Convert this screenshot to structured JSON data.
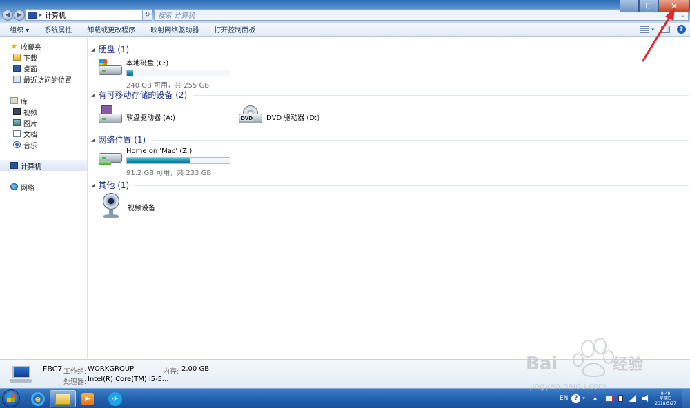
{
  "address": {
    "location": "计算机"
  },
  "search": {
    "placeholder": "搜索 计算机"
  },
  "toolbar": {
    "organize": "组织 ▾",
    "system_properties": "系统属性",
    "uninstall": "卸载或更改程序",
    "map_drive": "映射网络驱动器",
    "control_panel": "打开控制面板"
  },
  "nav": {
    "favorites": "收藏夹",
    "downloads": "下载",
    "desktop": "桌面",
    "recent": "最近访问的位置",
    "libraries": "库",
    "videos": "视频",
    "pictures": "图片",
    "documents": "文档",
    "music": "音乐",
    "computer": "计算机",
    "network": "网络"
  },
  "groups": {
    "hdd": {
      "title": "硬盘 (1)"
    },
    "removable": {
      "title": "有可移动存储的设备 (2)"
    },
    "network": {
      "title": "网络位置 (1)"
    },
    "other": {
      "title": "其他 (1)"
    }
  },
  "items": {
    "local_c": {
      "name": "本地磁盘 (C:)",
      "free": "240 GB 可用，共 255 GB",
      "used_fraction": 0.06
    },
    "floppy_a": {
      "name": "软盘驱动器 (A:)"
    },
    "dvd_d": {
      "name": "DVD 驱动器 (D:)",
      "disc_label": "DVD"
    },
    "mac_z": {
      "name": "Home on 'Mac' (Z:)",
      "free": "91.2 GB 可用，共 233 GB",
      "used_fraction": 0.61
    },
    "camera": {
      "name": "视频设备"
    }
  },
  "details": {
    "computer_name": "FBC7",
    "workgroup_label": "工作组:",
    "workgroup_value": "WORKGROUP",
    "memory_label": "内存:",
    "memory_value": "2.00 GB",
    "cpu_label": "处理器:",
    "cpu_value": "Intel(R) Core(TM) i5-5..."
  },
  "tray": {
    "lang": "EN",
    "time": "9:49",
    "weekday": "星期日",
    "date": "2018/5/27"
  },
  "colors": {
    "accent_arrow": "#e0262a",
    "drive_bar": "#1687ad",
    "group_title": "#1e3287"
  }
}
